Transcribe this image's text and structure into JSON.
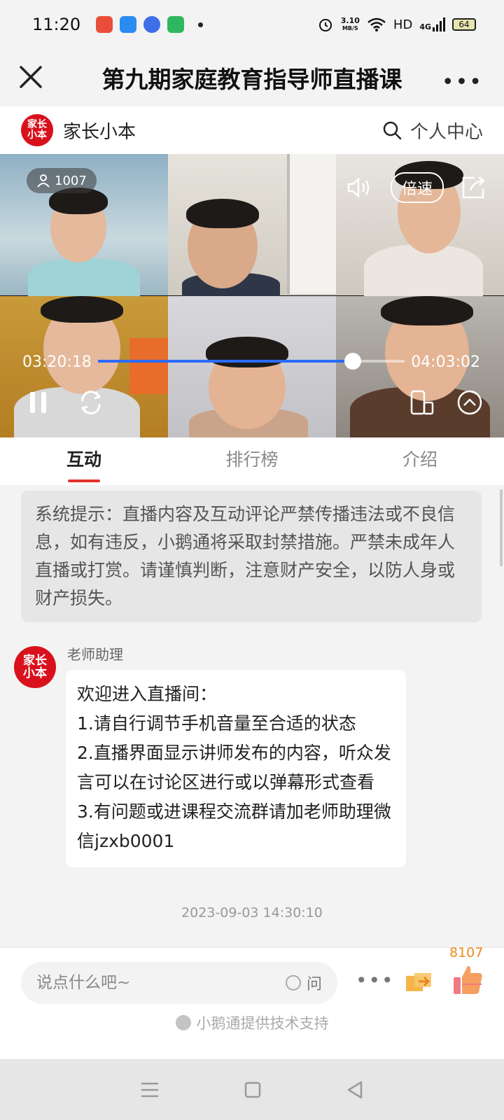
{
  "status_bar": {
    "time": "11:20",
    "net_speed_value": "3.10",
    "net_speed_unit": "MB/S",
    "hd_label": "HD",
    "signal_label": "4G",
    "battery": "64"
  },
  "title_bar": {
    "title": "第九期家庭教育指导师直播课",
    "more_label": "•••"
  },
  "brand_bar": {
    "logo_text": "家长小本",
    "brand_name": "家长小本",
    "profile_link": "个人中心"
  },
  "video": {
    "viewer_count": "1007",
    "speed_label": "倍速",
    "current_time": "03:20:18",
    "total_time": "04:03:02",
    "progress": 0.83
  },
  "tabs": [
    {
      "label": "互动",
      "active": true
    },
    {
      "label": "排行榜",
      "active": false
    },
    {
      "label": "介绍",
      "active": false
    }
  ],
  "chat": {
    "system_notice": "系统提示：直播内容及互动评论严禁传播违法或不良信息，如有违反，小鹅通将采取封禁措施。严禁未成年人直播或打赏。请谨慎判断，注意财产安全，以防人身或财产损失。",
    "messages": [
      {
        "sender": "老师助理",
        "avatar_text": "家长小本",
        "lines": [
          "欢迎进入直播间：",
          "1.请自行调节手机音量至合适的状态",
          "2.直播界面显示讲师发布的内容，听众发言可以在讨论区进行或以弹幕形式查看",
          "3.有问题或进课程交流群请加老师助理微信jzxb0001"
        ]
      }
    ],
    "timestamp": "2023-09-03 14:30:10"
  },
  "input_bar": {
    "placeholder": "说点什么吧~",
    "ask_label": "问",
    "more_label": "•••",
    "like_count": "8107",
    "powered_by": "小鹅通提供技术支持"
  },
  "colors": {
    "accent_red": "#e5322d",
    "brand_red": "#d8111d",
    "progress_blue": "#2b6bff",
    "like_orange": "#ef8a1f"
  }
}
